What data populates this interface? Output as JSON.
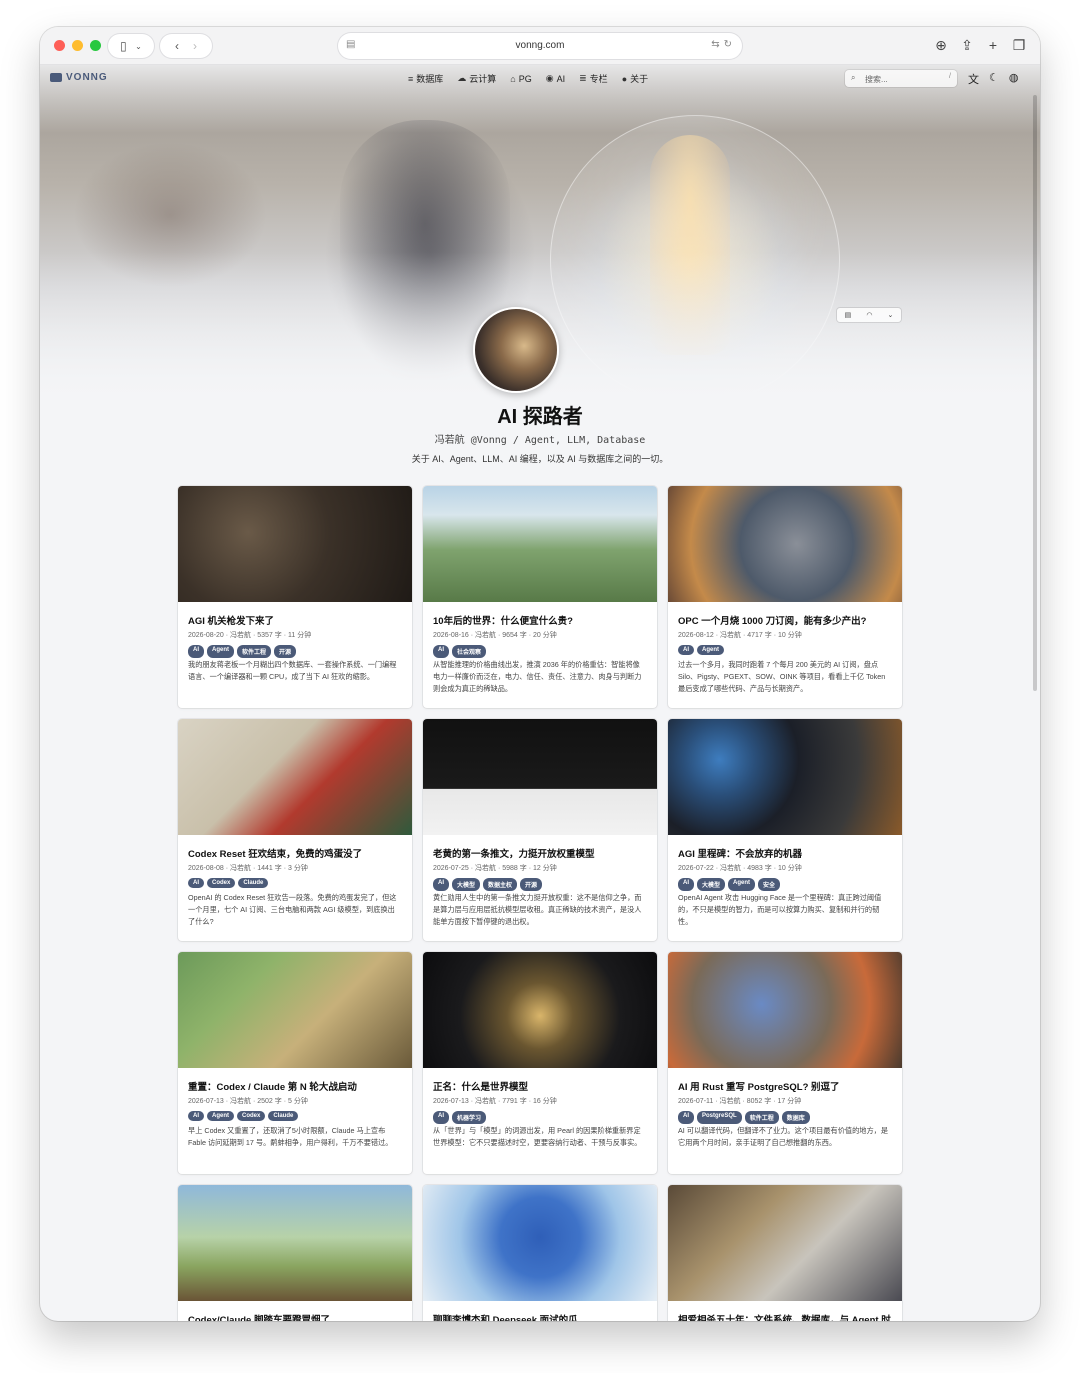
{
  "browser": {
    "url": "vonng.com"
  },
  "site": {
    "logo": "VONNG",
    "nav": [
      {
        "icon": "database-icon",
        "label": "数据库"
      },
      {
        "icon": "cloud-icon",
        "label": "云计算"
      },
      {
        "icon": "postgres-icon",
        "label": "PG"
      },
      {
        "icon": "robot-icon",
        "label": "AI"
      },
      {
        "icon": "stack-icon",
        "label": "专栏"
      },
      {
        "icon": "user-icon",
        "label": "关于"
      }
    ],
    "search_placeholder": "搜索...",
    "search_shortcut": "/"
  },
  "profile": {
    "title": "AI 探路者",
    "subtitle": "冯若航 @Vonng / Agent, LLM, Database",
    "description": "关于 AI、Agent、LLM、AI 编程，以及 AI 与数据库之间的一切。"
  },
  "posts": [
    {
      "title": "AGI 机关枪发下来了",
      "meta": "2026-08-20 · 冯若航 · 5357 字 · 11 分钟",
      "tags": [
        "AI",
        "Agent",
        "软件工程",
        "开源"
      ],
      "excerpt": "我的朋友蒋老板一个月糊出四个数据库、一套操作系统、一门编程语言、一个编译器和一颗 CPU，成了当下 AI 狂欢的缩影。"
    },
    {
      "title": "10年后的世界：什么便宜什么贵?",
      "meta": "2026-08-16 · 冯若航 · 9654 字 · 20 分钟",
      "tags": [
        "AI",
        "社会观察"
      ],
      "excerpt": "从智能推理的价格曲线出发，推演 2036 年的价格重估：智能将像电力一样廉价而泛在，电力、信任、责任、注意力、肉身与判断力则会成为真正的稀缺品。"
    },
    {
      "title": "OPC 一个月烧 1000 刀订阅，能有多少产出?",
      "meta": "2026-08-12 · 冯若航 · 4717 字 · 10 分钟",
      "tags": [
        "AI",
        "Agent"
      ],
      "excerpt": "过去一个多月，我同时跑着 7 个每月 200 美元的 AI 订阅，盘点 Silo、Pigsty、PGEXT、SOW、OINK 等项目，看看上千亿 Token 最后变成了哪些代码、产品与长期资产。"
    },
    {
      "title": "Codex Reset 狂欢结束，免费的鸡蛋没了",
      "meta": "2026-08-08 · 冯若航 · 1441 字 · 3 分钟",
      "tags": [
        "AI",
        "Codex",
        "Claude"
      ],
      "excerpt": "OpenAI 的 Codex Reset 狂欢告一段落。免费的鸡蛋发完了，但这一个月里，七个 AI 订阅、三台电脑和两款 AGI 级模型，到底换出了什么?"
    },
    {
      "title": "老黄的第一条推文，力挺开放权重模型",
      "meta": "2026-07-25 · 冯若航 · 5988 字 · 12 分钟",
      "tags": [
        "AI",
        "大模型",
        "数据主权",
        "开源"
      ],
      "excerpt": "黄仁勋用人生中的第一条推文力挺开放权重：这不是信仰之争，而是算力层与应用层抵抗模型层收租。真正稀缺的技术资产，是没人能单方面按下暂停键的退出权。"
    },
    {
      "title": "AGI 里程碑：不会放弃的机器",
      "meta": "2026-07-22 · 冯若航 · 4983 字 · 10 分钟",
      "tags": [
        "AI",
        "大模型",
        "Agent",
        "安全"
      ],
      "excerpt": "OpenAI Agent 攻击 Hugging Face 是一个里程碑：真正跨过阈值的，不只是模型的智力，而是可以按算力购买、复制和并行的韧性。"
    },
    {
      "title": "重置：Codex / Claude 第 N 轮大战启动",
      "meta": "2026-07-13 · 冯若航 · 2502 字 · 5 分钟",
      "tags": [
        "AI",
        "Agent",
        "Codex",
        "Claude"
      ],
      "excerpt": "早上 Codex 又重置了，还取消了5小时限额，Claude 马上宣布 Fable 访问延期到 17 号。鹬蚌相争，用户得利，千万不要错过。"
    },
    {
      "title": "正名：什么是世界模型",
      "meta": "2026-07-13 · 冯若航 · 7791 字 · 16 分钟",
      "tags": [
        "AI",
        "机器学习"
      ],
      "excerpt": "从「世界」与「模型」的词源出发，用 Pearl 的因果阶梯重新界定世界模型：它不只要描述时空，更要容纳行动者、干预与反事实。"
    },
    {
      "title": "AI 用 Rust 重写 PostgreSQL? 别逗了",
      "meta": "2026-07-11 · 冯若航 · 8052 字 · 17 分钟",
      "tags": [
        "AI",
        "PostgreSQL",
        "软件工程",
        "数据库"
      ],
      "excerpt": "AI 可以翻译代码，但翻译不了业力。这个项目最有价值的地方，是它用两个月时间，亲手证明了自己想推翻的东西。"
    },
    {
      "title": "Codex/Claude 脚踏车要蹬冒烟了",
      "meta": "",
      "tags": [],
      "excerpt": ""
    },
    {
      "title": "聊聊李博杰和 Deepseek 面试的瓜",
      "meta": "",
      "tags": [],
      "excerpt": ""
    },
    {
      "title": "相爱相杀五十年：文件系统、数据库，与 Agent 时",
      "meta": "",
      "tags": [],
      "excerpt": ""
    }
  ],
  "colors": {
    "tag_bg": "#4b5a78",
    "logo": "#4a5a7a"
  }
}
